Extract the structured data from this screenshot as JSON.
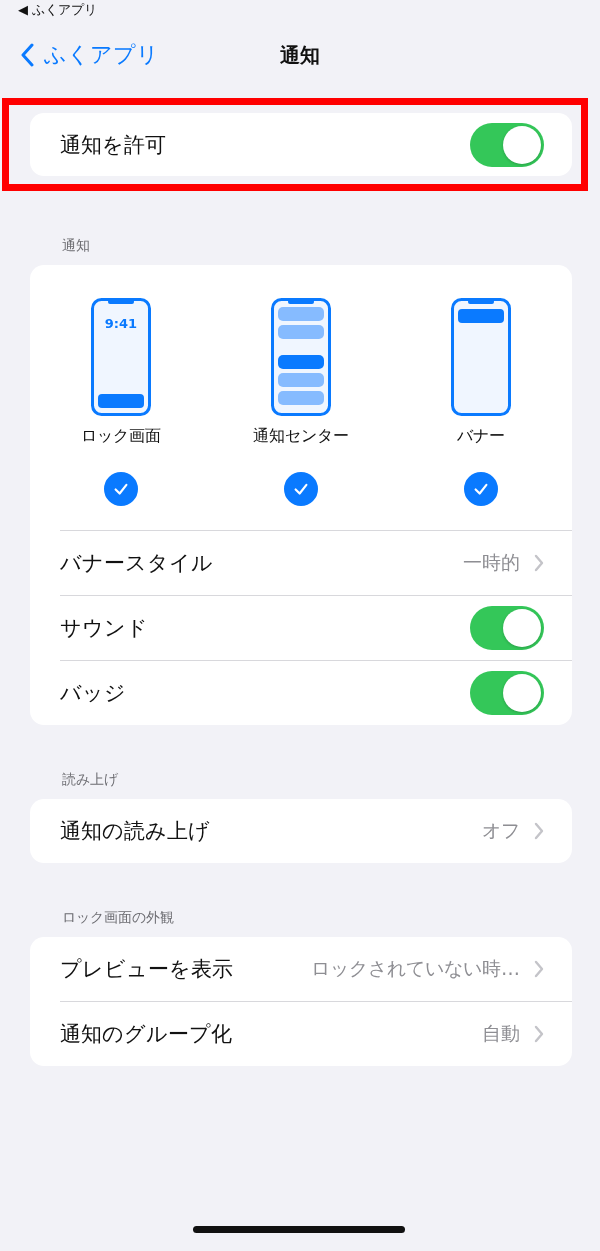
{
  "status_bar": {
    "back_label": "◀ ふくアプリ"
  },
  "nav": {
    "back_label": "ふくアプリ",
    "title": "通知"
  },
  "allow": {
    "label": "通知を許可",
    "on": true,
    "highlighted": true
  },
  "sections": [
    {
      "header": "通知",
      "styles": [
        {
          "kind": "lock",
          "clock": "9:41",
          "label": "ロック画面",
          "checked": true
        },
        {
          "kind": "center",
          "label": "通知センター",
          "checked": true
        },
        {
          "kind": "banner",
          "label": "バナー",
          "checked": true
        }
      ],
      "rows": [
        {
          "kind": "value",
          "label": "バナースタイル",
          "value": "一時的"
        },
        {
          "kind": "toggle",
          "label": "サウンド",
          "on": true
        },
        {
          "kind": "toggle",
          "label": "バッジ",
          "on": true
        }
      ]
    },
    {
      "header": "読み上げ",
      "rows": [
        {
          "kind": "value",
          "label": "通知の読み上げ",
          "value": "オフ"
        }
      ]
    },
    {
      "header": "ロック画面の外観",
      "rows": [
        {
          "kind": "value",
          "label": "プレビューを表示",
          "value": "ロックされていない時…"
        },
        {
          "kind": "value",
          "label": "通知のグループ化",
          "value": "自動"
        }
      ]
    }
  ]
}
